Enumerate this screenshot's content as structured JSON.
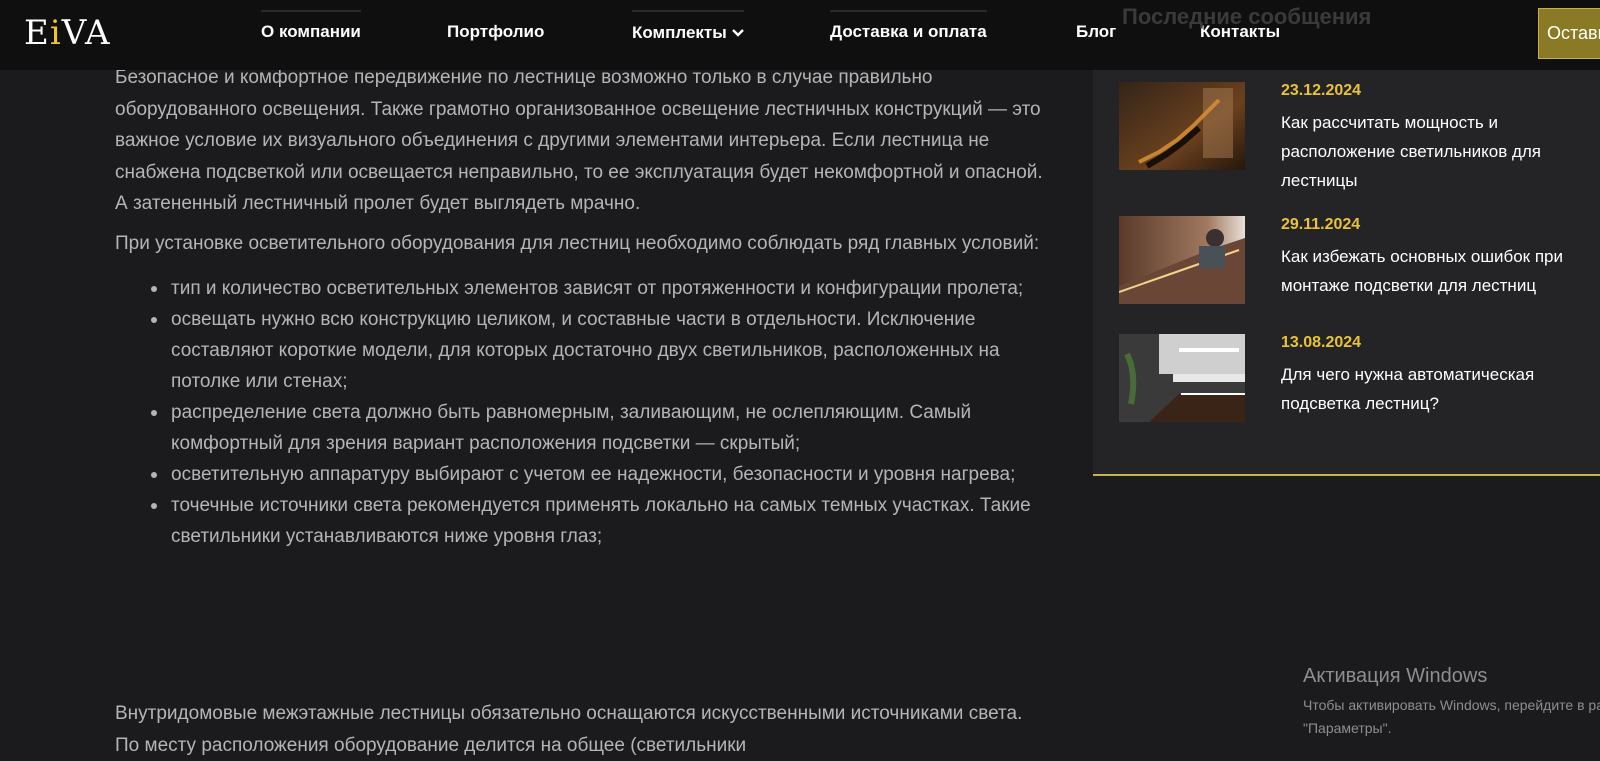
{
  "header": {
    "logo_text": "EiVA",
    "nav": [
      "О компании",
      "Портфолио",
      "Комплекты",
      "Доставка и оплата",
      "Блог",
      "Контакты"
    ],
    "cta_label": "Оставить заявку"
  },
  "sidebar": {
    "heading": "Последние сообщения",
    "posts": [
      {
        "date": "23.12.2024",
        "title": "Как рассчитать мощность и расположение светильников для лестницы"
      },
      {
        "date": "29.11.2024",
        "title": "Как избежать основных ошибок при монтаже подсветки для лестниц"
      },
      {
        "date": "13.08.2024",
        "title": "Для чего нужна автоматическая подсветка лестниц?"
      }
    ]
  },
  "article": {
    "para1": "Безопасное и комфортное передвижение по лестнице возможно только в случае правильно оборудованного освещения. Также грамотно организованное освещение лестничных конструкций — это важное условие их визуального объединения с другими элементами интерьера. Если лестница не снабжена подсветкой или освещается неправильно, то ее эксплуатация будет некомфортной и опасной. А затененный лестничный пролет будет выглядеть мрачно.",
    "para2": "При установке осветительного оборудования для лестниц необходимо соблюдать ряд главных условий:",
    "bullets": [
      "тип и количество осветительных элементов зависят от протяженности и конфигурации пролета;",
      "освещать нужно всю конструкцию целиком, и составные части в отдельности. Исключение составляют короткие модели, для которых достаточно двух светильников, расположенных на потолке или стенах;",
      "распределение света должно быть равномерным, заливающим, не ослепляющим. Самый комфортный для зрения вариант расположения подсветки — скрытый;",
      "осветительную аппаратуру выбирают с учетом ее надежности, безопасности и уровня нагрева;",
      " точечные источники света рекомендуется применять локально на самых темных участках. Такие светильники устанавливаются ниже уровня глаз;"
    ],
    "para3": "Внутридомовые межэтажные лестницы обязательно оснащаются искусственными источниками света. По месту расположения оборудование делится на общее (светильники"
  },
  "watermark": {
    "title": "Активация Windows",
    "line1": "Чтобы активировать Windows, перейдите в раздел",
    "line2": "\"Параметры\"."
  },
  "colors": {
    "background": "#1b1b1d",
    "header": "#0f0f10",
    "accent_yellow": "#e9c23a",
    "cta": "#8a7a25",
    "sidebar": "#242426"
  }
}
